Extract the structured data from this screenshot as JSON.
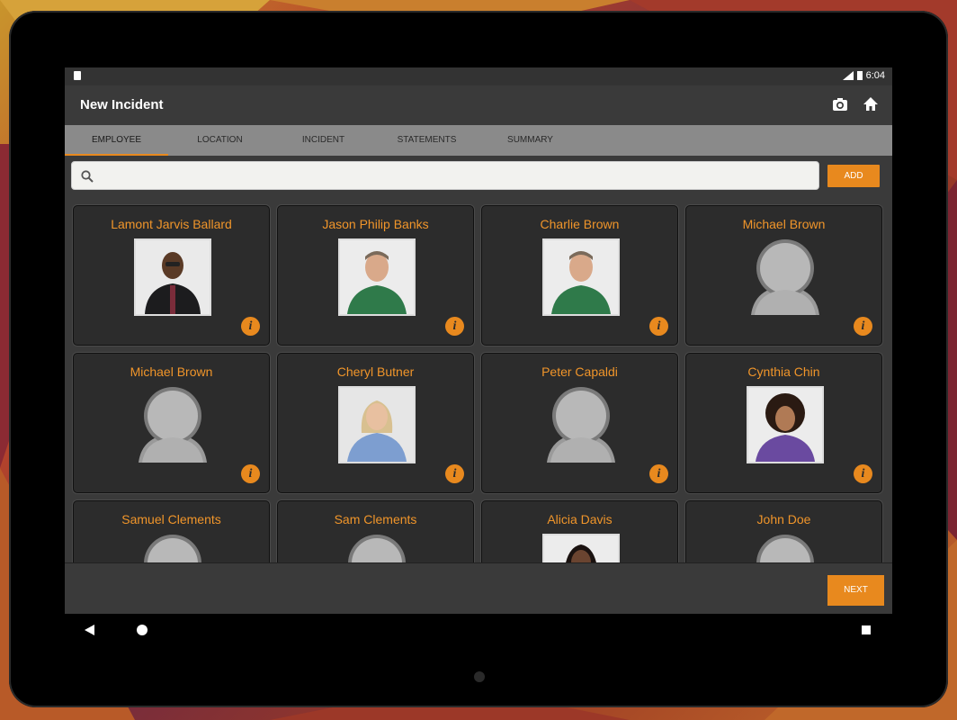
{
  "status_bar": {
    "time": "6:04"
  },
  "app_bar": {
    "title": "New Incident",
    "camera_icon": "camera-icon",
    "home_icon": "home-icon"
  },
  "tabs": [
    {
      "label": "EMPLOYEE",
      "active": true
    },
    {
      "label": "LOCATION",
      "active": false
    },
    {
      "label": "INCIDENT",
      "active": false
    },
    {
      "label": "STATEMENTS",
      "active": false
    },
    {
      "label": "SUMMARY",
      "active": false
    }
  ],
  "search": {
    "value": "",
    "placeholder": ""
  },
  "add_label": "ADD",
  "employees": [
    {
      "name": "Lamont Jarvis Ballard",
      "photo": "man-dark-glasses"
    },
    {
      "name": "Jason Philip Banks",
      "photo": "man-green-shirt"
    },
    {
      "name": "Charlie Brown",
      "photo": "man-green-shirt"
    },
    {
      "name": "Michael Brown",
      "photo": "placeholder"
    },
    {
      "name": "Michael Brown",
      "photo": "placeholder"
    },
    {
      "name": "Cheryl Butner",
      "photo": "woman-blonde"
    },
    {
      "name": "Peter Capaldi",
      "photo": "placeholder"
    },
    {
      "name": "Cynthia Chin",
      "photo": "woman-curly"
    },
    {
      "name": "Samuel Clements",
      "photo": "placeholder"
    },
    {
      "name": "Sam Clements",
      "photo": "placeholder"
    },
    {
      "name": "Alicia Davis",
      "photo": "woman-dark"
    },
    {
      "name": "John Doe",
      "photo": "placeholder"
    }
  ],
  "info_glyph": "i",
  "next_label": "NEXT",
  "colors": {
    "accent": "#e8891e",
    "card_bg": "#2c2c2c",
    "screen_bg": "#3a3a3a",
    "tab_bg": "#8a8a8a"
  }
}
